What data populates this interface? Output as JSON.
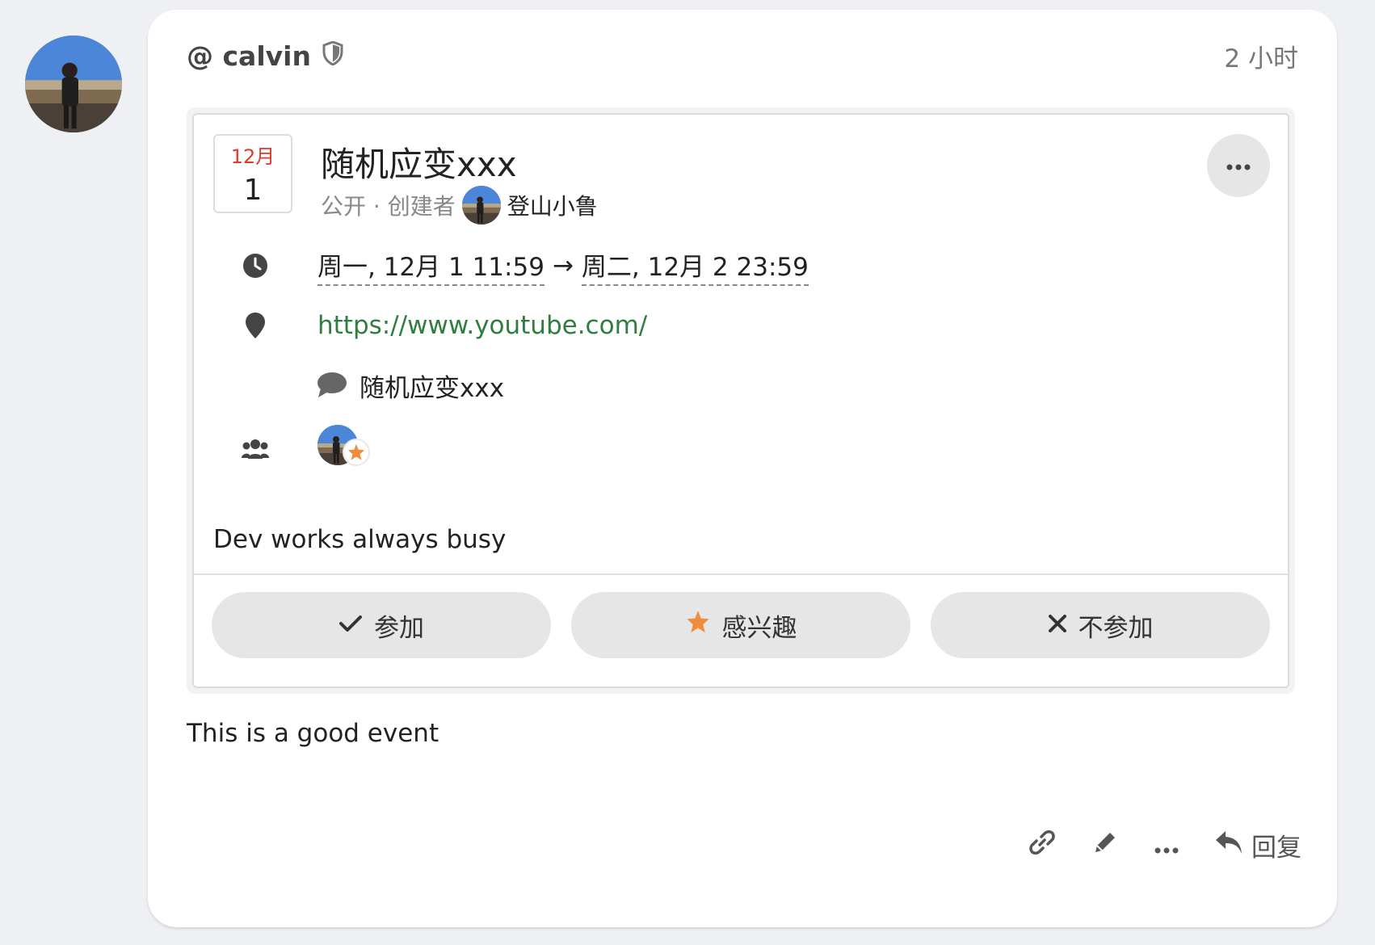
{
  "author": {
    "handle": "@ calvin",
    "icon": "shield-icon"
  },
  "post": {
    "timestamp": "2 小时",
    "body": "This is a good event"
  },
  "event": {
    "month": "12月",
    "day": "1",
    "title": "随机应变xxx",
    "visibility": "公开 · 创建者",
    "creator": "登山小鲁",
    "start": "周一, 12月 1 11:59",
    "arrow": "→",
    "end": "周二, 12月 2 23:59",
    "location": "https://www.youtube.com/",
    "chat": "随机应变xxx",
    "description": "Dev works always busy"
  },
  "rsvp": {
    "join": "参加",
    "interested": "感兴趣",
    "decline": "不参加"
  },
  "actions": {
    "reply": "回复"
  },
  "colors": {
    "accent_red": "#e03a2a",
    "link_green": "#2f7d3f",
    "star_orange": "#f08c3c"
  }
}
